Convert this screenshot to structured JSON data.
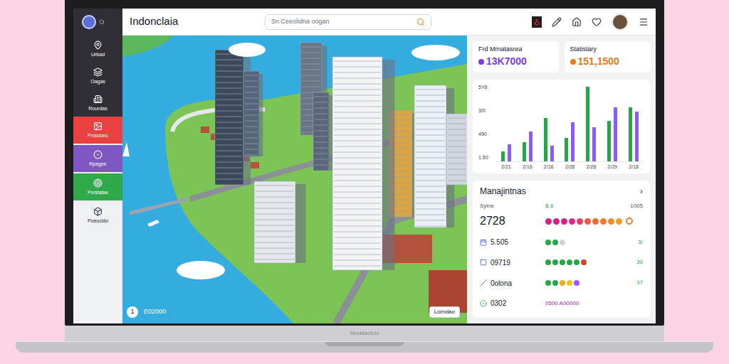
{
  "app": {
    "title": "Indonclaia"
  },
  "search": {
    "placeholder": "Sn Ceeolidna oogan"
  },
  "sidebar": {
    "items": [
      {
        "label": "Urbad",
        "kind": "dark",
        "color": "#2f2f35"
      },
      {
        "label": "Oagas",
        "kind": "dark",
        "color": "#2f2f35"
      },
      {
        "label": "Rourdas",
        "kind": "dark",
        "color": "#2f2f35"
      },
      {
        "label": "Prolcides",
        "kind": "accent",
        "color": "#e8413f"
      },
      {
        "label": "Rpegee",
        "kind": "accent",
        "color": "#7e57c2"
      },
      {
        "label": "Porsialae",
        "kind": "accent",
        "color": "#2eaa4a"
      },
      {
        "label": "Poeucldo",
        "kind": "light",
        "color": "#eef0f2"
      }
    ]
  },
  "map": {
    "badge": "1",
    "reading": "E02000",
    "place": "Lorndao"
  },
  "stats": [
    {
      "label": "Frd Mrnatasrea",
      "value": "13K7000",
      "color": "#7c3aed"
    },
    {
      "label": "Statistary",
      "value": "151,1500",
      "color": "#ea7a16"
    }
  ],
  "chart": {
    "y_ticks": [
      "5Y8",
      "3/0",
      "490",
      "1.50"
    ],
    "x_labels": [
      "2/21",
      "2/16",
      "2/16",
      "2/28",
      "2/28",
      "2/29",
      "2/18"
    ],
    "max": 5,
    "series": [
      {
        "color": "#22a846",
        "values": [
          0.6,
          1.2,
          2.8,
          1.5,
          4.8,
          2.6,
          3.5
        ]
      },
      {
        "color": "#8b5cf6",
        "values": [
          1.1,
          1.9,
          1.0,
          2.5,
          2.2,
          3.5,
          3.2
        ]
      }
    ]
  },
  "list": {
    "title": "Manajintnas",
    "chevron": "›",
    "header": {
      "label": "Sylne",
      "mid": "$ 8",
      "right": "1005"
    },
    "rows": [
      {
        "kind": "large",
        "label": "2728",
        "dots": [
          "#d61f8c",
          "#d61f8c",
          "#d61f8c",
          "#e0288a",
          "#e63c6a",
          "#f05a3c",
          "#f26b2e",
          "#f07a2a",
          "#f08a2a",
          "#f29a2a"
        ],
        "right": ""
      },
      {
        "kind": "dots",
        "label": "5.505",
        "dots": [
          "#22a846",
          "#22a846",
          "#d4d4d4"
        ],
        "right": "3/"
      },
      {
        "kind": "dots",
        "label": "09719",
        "dots": [
          "#22a846",
          "#22a846",
          "#22a846",
          "#22a846",
          "#22a846",
          "#e23b2e"
        ],
        "right": "30"
      },
      {
        "kind": "dots",
        "label": "0olona",
        "dots": [
          "#22a846",
          "#22a846",
          "#f5a623",
          "#f5c518",
          "#a855f7"
        ],
        "right": "37"
      },
      {
        "kind": "text",
        "label": "0302",
        "text": "0500 A00000",
        "right": ""
      }
    ]
  },
  "laptop": {
    "brand": "Mnddaolcio"
  }
}
